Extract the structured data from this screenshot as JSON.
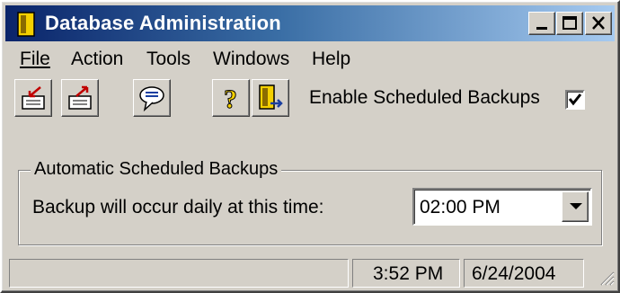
{
  "window": {
    "title": "Database Administration"
  },
  "menu": {
    "items": [
      {
        "label": "File"
      },
      {
        "label": "Action"
      },
      {
        "label": "Tools"
      },
      {
        "label": "Windows"
      },
      {
        "label": "Help"
      }
    ]
  },
  "toolbar": {
    "buttons": [
      {
        "icon": "import-icon"
      },
      {
        "icon": "export-icon"
      },
      {
        "icon": "chat-bubble-icon"
      },
      {
        "icon": "help-icon"
      },
      {
        "icon": "exit-door-icon"
      }
    ]
  },
  "options": {
    "enable_scheduled_backups_label": "Enable Scheduled Backups",
    "enable_scheduled_backups_checked": true
  },
  "group": {
    "title": "Automatic Scheduled Backups",
    "backup_time_label": "Backup will occur daily at this time:",
    "backup_time_value": "02:00 PM"
  },
  "statusbar": {
    "message": "",
    "time": "3:52 PM",
    "date": "6/24/2004"
  },
  "colors": {
    "face": "#d4d0c8",
    "title_start": "#0a246a",
    "title_end": "#a6caf0"
  }
}
